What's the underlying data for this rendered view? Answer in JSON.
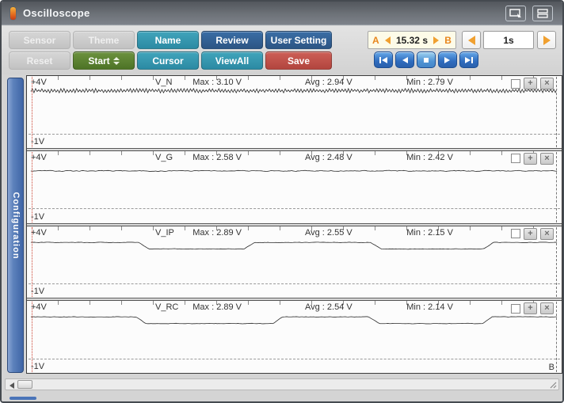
{
  "window": {
    "title": "Oscilloscope"
  },
  "toolbar": {
    "row1": [
      {
        "label": "Sensor",
        "style": "gray"
      },
      {
        "label": "Theme",
        "style": "gray"
      },
      {
        "label": "Name",
        "style": "teal"
      },
      {
        "label": "Review",
        "style": "blue"
      },
      {
        "label": "User Setting",
        "style": "blue"
      }
    ],
    "row2": [
      {
        "label": "Reset",
        "style": "gray"
      },
      {
        "label": "Start",
        "style": "green"
      },
      {
        "label": "Cursor",
        "style": "teal"
      },
      {
        "label": "ViewAll",
        "style": "teal"
      },
      {
        "label": "Save",
        "style": "red"
      }
    ]
  },
  "range_control": {
    "a_label": "A",
    "b_label": "B",
    "value": "15.32 s"
  },
  "timebase": {
    "value": "1s"
  },
  "playback": {
    "buttons": [
      "skip-to-start",
      "step-back",
      "stop",
      "step-forward",
      "skip-to-end"
    ]
  },
  "sidebar": {
    "label": "Configuration"
  },
  "scope": {
    "top_label": "+4V",
    "bottom_label": "-1V",
    "cursor_b_label": "B"
  },
  "channels": [
    {
      "name": "V_N",
      "max": "Max : 3.10 V",
      "avg": "Avg : 2.94 V",
      "min": "Min : 2.79 V"
    },
    {
      "name": "V_G",
      "max": "Max : 2.58 V",
      "avg": "Avg : 2.48 V",
      "min": "Min : 2.42 V"
    },
    {
      "name": "V_IP",
      "max": "Max : 2.89 V",
      "avg": "Avg : 2.55 V",
      "min": "Min : 2.15 V"
    },
    {
      "name": "V_RC",
      "max": "Max : 2.89 V",
      "avg": "Avg : 2.54 V",
      "min": "Min : 2.14 V"
    }
  ],
  "chart_data": {
    "type": "line",
    "ylim": [
      -1,
      4
    ],
    "y_axis_labels": {
      "top": "+4V",
      "bottom": "-1V"
    },
    "x_window_seconds": 15.32,
    "grid": "dashed baseline at -1V, tick marks along top edge",
    "series": [
      {
        "name": "V_N",
        "max_v": 3.1,
        "avg_v": 2.94,
        "min_v": 2.79,
        "style": "zigzag",
        "noise_v": 0.13,
        "segments": [
          [
            0,
            1,
            2.94
          ]
        ]
      },
      {
        "name": "V_G",
        "max_v": 2.58,
        "avg_v": 2.48,
        "min_v": 2.42,
        "style": "smooth",
        "noise_v": 0.035,
        "segments": [
          [
            0,
            1,
            2.48
          ]
        ]
      },
      {
        "name": "V_IP",
        "max_v": 2.89,
        "avg_v": 2.55,
        "min_v": 2.15,
        "style": "smooth",
        "noise_v": 0.02,
        "segments": [
          [
            0,
            0.205,
            2.82
          ],
          [
            0.225,
            0.405,
            2.22
          ],
          [
            0.425,
            0.645,
            2.82
          ],
          [
            0.665,
            0.86,
            2.22
          ],
          [
            0.878,
            1,
            2.82
          ]
        ]
      },
      {
        "name": "V_RC",
        "max_v": 2.89,
        "avg_v": 2.54,
        "min_v": 2.14,
        "style": "smooth",
        "noise_v": 0.02,
        "segments": [
          [
            0,
            0.2,
            2.82
          ],
          [
            0.218,
            0.46,
            2.2
          ],
          [
            0.478,
            0.64,
            2.82
          ],
          [
            0.662,
            0.858,
            2.2
          ],
          [
            0.875,
            1,
            2.82
          ]
        ]
      }
    ]
  },
  "colors": {
    "teal": "#2f95ad",
    "blue": "#2f5f94",
    "green": "#567c2d",
    "red": "#bf4d46",
    "gray_disabled": "#c9c9c9",
    "playback_blue": "#2f6cbe",
    "orange_accent": "#f0a030",
    "sidebar_blue": "#4a74b8",
    "range_bg": "#fdfbe8",
    "titlebar": "#6d7278"
  }
}
